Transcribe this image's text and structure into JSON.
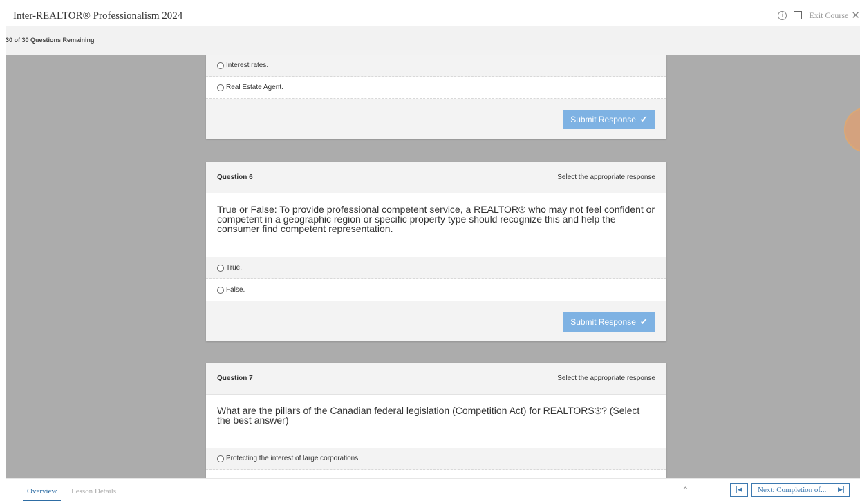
{
  "header": {
    "title": "Inter-REALTOR® Professionalism 2024",
    "info_glyph": "i",
    "exit_label": "Exit Course",
    "close_glyph": "✕"
  },
  "progress": {
    "text": "30 of 30 Questions Remaining"
  },
  "question5": {
    "options": [
      "Interest rates.",
      "Real Estate Agent."
    ],
    "submit_label": "Submit Response"
  },
  "question6": {
    "number": "Question 6",
    "hint": "Select the appropriate response",
    "text": "True or False: To provide professional competent service, a REALTOR® who may not feel confident or competent in a geographic region or specific property type should recognize this and help the consumer find competent representation.",
    "options": [
      "True.",
      "False."
    ],
    "submit_label": "Submit Response"
  },
  "question7": {
    "number": "Question 7",
    "hint": "Select the appropriate response",
    "text": "What are the pillars of the Canadian federal legislation (Competition Act) for REALTORS®? (Select the best answer)",
    "options": [
      "Protecting the interest of large corporations.",
      ""
    ]
  },
  "check_glyph": "✔",
  "footer": {
    "tabs": [
      "Overview",
      "Lesson Details"
    ],
    "up_glyph": "⌃",
    "prev_glyph": "|◀",
    "next_label": "Next: Completion of...",
    "next_glyph": "▶|"
  },
  "colors": {
    "accent": "#2e6da4",
    "submit": "#7eb2e3",
    "content_bg": "#acacac",
    "highlight_circle": "#d9a27a"
  }
}
